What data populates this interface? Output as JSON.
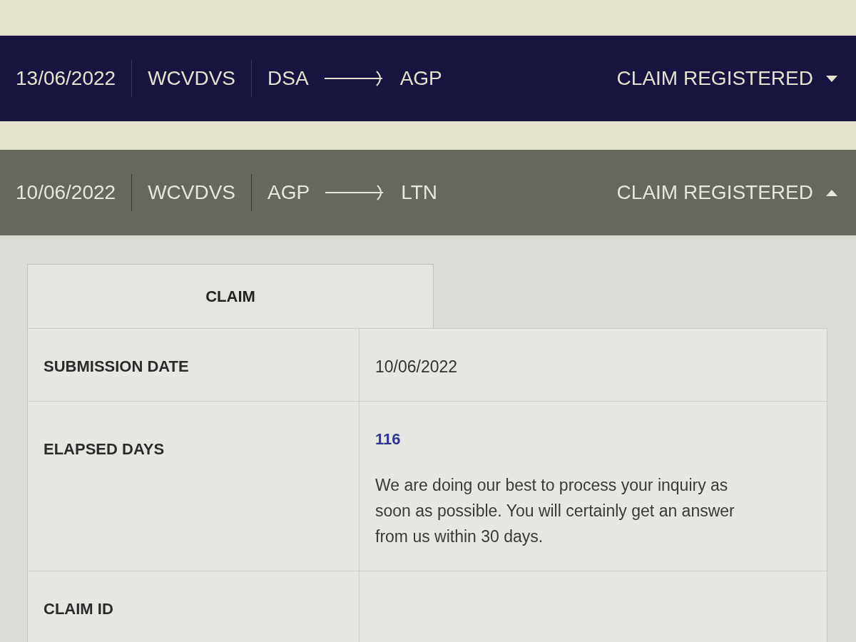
{
  "claims": [
    {
      "date": "13/06/2022",
      "reference": "WCVDVS",
      "origin": "DSA",
      "destination": "AGP",
      "status": "CLAIM REGISTERED",
      "expanded": false
    },
    {
      "date": "10/06/2022",
      "reference": "WCVDVS",
      "origin": "AGP",
      "destination": "LTN",
      "status": "CLAIM REGISTERED",
      "expanded": true,
      "details": {
        "tabs": [
          {
            "label": "CLAIM",
            "selected": true
          }
        ],
        "rows": [
          {
            "label": "SUBMISSION DATE",
            "kind": "text",
            "value": "10/06/2022"
          },
          {
            "label": "ELAPSED DAYS",
            "kind": "count",
            "value": "116",
            "note": "We are doing our best to process your inquiry as soon as possible. You will certainly get an answer from us within 30 days."
          },
          {
            "label": "CLAIM ID"
          }
        ]
      }
    }
  ]
}
